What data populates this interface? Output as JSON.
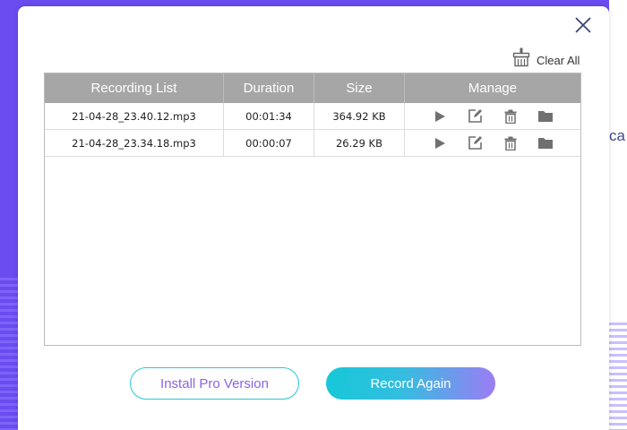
{
  "background": {
    "peek_text": "ca"
  },
  "dialog": {
    "clear_all_label": "Clear All",
    "table": {
      "headers": [
        "Recording List",
        "Duration",
        "Size",
        "Manage"
      ],
      "rows": [
        {
          "name": "21-04-28_23.40.12.mp3",
          "duration": "00:01:34",
          "size": "364.92 KB"
        },
        {
          "name": "21-04-28_23.34.18.mp3",
          "duration": "00:00:07",
          "size": "26.29 KB"
        }
      ],
      "manage_icons": [
        "play-icon",
        "edit-icon",
        "trash-icon",
        "folder-icon"
      ]
    },
    "buttons": {
      "install_pro": "Install Pro Version",
      "record_again": "Record Again"
    }
  },
  "colors": {
    "background_purple": "#6a4cf0",
    "header_gray": "#a6a6a6",
    "accent_cyan": "#16c8d8",
    "accent_purple": "#9c7cf5"
  }
}
